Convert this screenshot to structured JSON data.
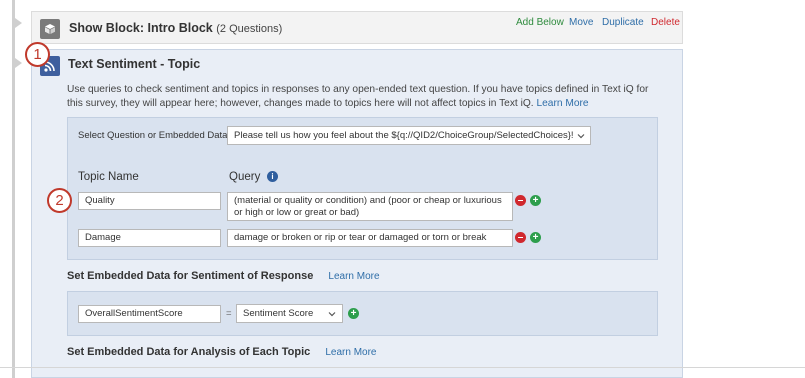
{
  "block": {
    "title": "Show Block: Intro Block",
    "count": "(2 Questions)",
    "actions": {
      "add_below": "Add Below",
      "move": "Move",
      "duplicate": "Duplicate",
      "delete": "Delete"
    }
  },
  "element": {
    "title": "Text Sentiment - Topic",
    "description": "Use queries to check sentiment and topics in responses to any open-ended text question. If you have topics defined in Text iQ for this survey, they will appear here; however, changes made to topics here will not affect topics in Text iQ.",
    "learn_more": "Learn More"
  },
  "badges": {
    "one": "1",
    "two": "2"
  },
  "question_select": {
    "label": "Select Question or Embedded Data",
    "value": "Please tell us how you feel about the ${q://QID2/ChoiceGroup/SelectedChoices}!"
  },
  "topics": {
    "col_topic": "Topic Name",
    "col_query": "Query",
    "rows": [
      {
        "name": "Quality",
        "query": "(material or quality or condition) and (poor or cheap or luxurious or high or low or great or bad)"
      },
      {
        "name": "Damage",
        "query": "damage or broken or rip or tear or damaged or torn or break"
      }
    ]
  },
  "sentiment_section": {
    "title": "Set Embedded Data for Sentiment of Response",
    "learn_more": "Learn More",
    "field_value": "OverallSentimentScore",
    "equals": "=",
    "select_value": "Sentiment Score"
  },
  "topic_section": {
    "title": "Set Embedded Data for Analysis of Each Topic",
    "learn_more": "Learn More"
  },
  "colors": {
    "link": "#2f6ea8",
    "add_below": "#2e8b3d",
    "delete": "#d0282e",
    "badge": "#c0392b",
    "panel_bg": "#e9eef6"
  }
}
